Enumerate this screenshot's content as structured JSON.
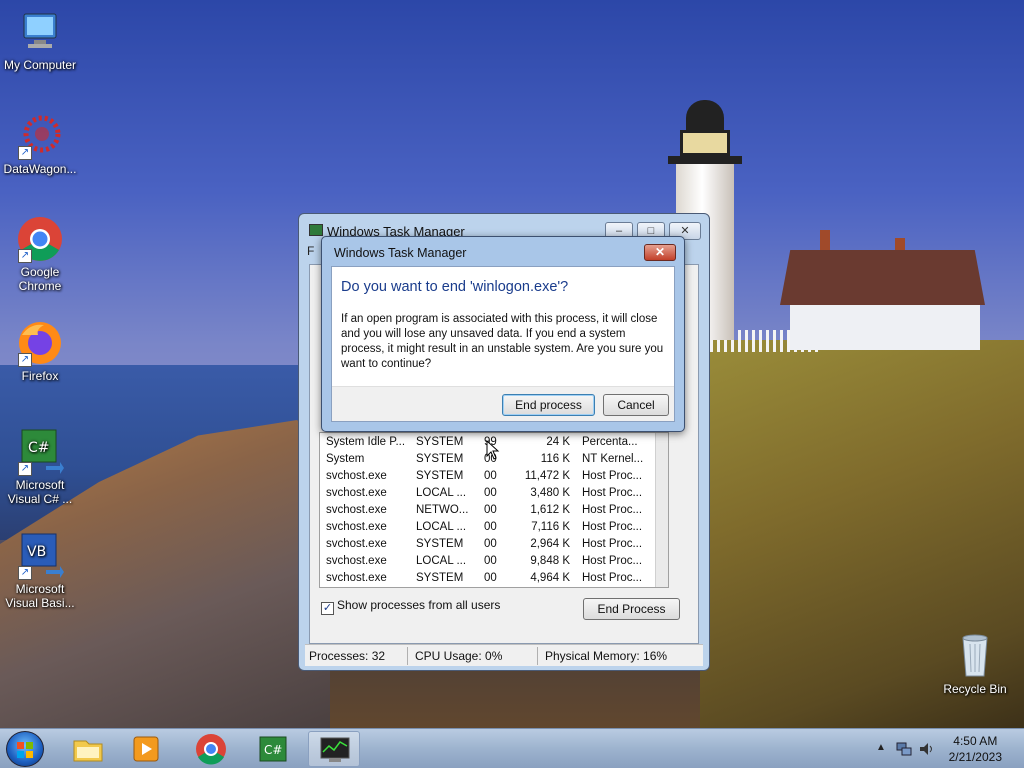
{
  "desktop": {
    "icons": [
      {
        "label": "My Computer",
        "icon": "computer-icon"
      },
      {
        "label": "DataWagon...",
        "icon": "datawagon-icon"
      },
      {
        "label": "Google Chrome",
        "icon": "chrome-icon"
      },
      {
        "label": "Firefox",
        "icon": "firefox-icon"
      },
      {
        "label": "Microsoft Visual C# ...",
        "icon": "visual-csharp-icon"
      },
      {
        "label": "Microsoft Visual Basi...",
        "icon": "visual-basic-icon"
      },
      {
        "label": "Recycle Bin",
        "icon": "recycle-bin-icon"
      }
    ]
  },
  "task_manager": {
    "title": "Windows Task Manager",
    "menu_first": "F",
    "processes": [
      {
        "name": "System Idle P...",
        "user": "SYSTEM",
        "cpu": "99",
        "memory": "24 K",
        "description": "Percenta..."
      },
      {
        "name": "System",
        "user": "SYSTEM",
        "cpu": "00",
        "memory": "116 K",
        "description": "NT Kernel..."
      },
      {
        "name": "svchost.exe",
        "user": "SYSTEM",
        "cpu": "00",
        "memory": "11,472 K",
        "description": "Host Proc..."
      },
      {
        "name": "svchost.exe",
        "user": "LOCAL ...",
        "cpu": "00",
        "memory": "3,480 K",
        "description": "Host Proc..."
      },
      {
        "name": "svchost.exe",
        "user": "NETWO...",
        "cpu": "00",
        "memory": "1,612 K",
        "description": "Host Proc..."
      },
      {
        "name": "svchost.exe",
        "user": "LOCAL ...",
        "cpu": "00",
        "memory": "7,116 K",
        "description": "Host Proc..."
      },
      {
        "name": "svchost.exe",
        "user": "SYSTEM",
        "cpu": "00",
        "memory": "2,964 K",
        "description": "Host Proc..."
      },
      {
        "name": "svchost.exe",
        "user": "LOCAL ...",
        "cpu": "00",
        "memory": "9,848 K",
        "description": "Host Proc..."
      },
      {
        "name": "svchost.exe",
        "user": "SYSTEM",
        "cpu": "00",
        "memory": "4,964 K",
        "description": "Host Proc..."
      }
    ],
    "show_all_label": "Show processes from all users",
    "show_all_checked": true,
    "end_process_label": "End Process",
    "status": {
      "processes": "Processes: 32",
      "cpu": "CPU Usage: 0%",
      "memory": "Physical Memory: 16%"
    }
  },
  "dialog": {
    "title": "Windows Task Manager",
    "close_glyph": "✕",
    "heading": "Do you want to end 'winlogon.exe'?",
    "body": "If an open program is associated with this process, it will close and you will lose any unsaved data. If you end a system process, it might result in an unstable system. Are you sure you want to continue?",
    "confirm_label": "End process",
    "cancel_label": "Cancel"
  },
  "taskbar": {
    "items": [
      "start-orb",
      "explorer-icon",
      "media-player-icon",
      "chrome-icon",
      "visual-csharp-icon",
      "task-manager-icon"
    ],
    "clock": {
      "time": "4:50 AM",
      "date": "2/21/2023"
    }
  }
}
